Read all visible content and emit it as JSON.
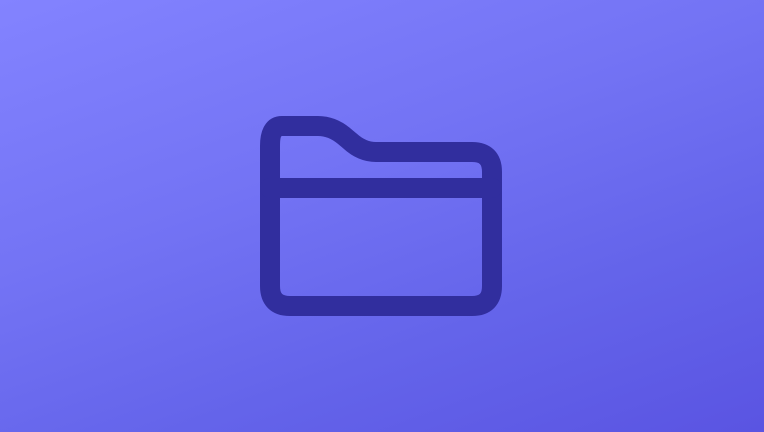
{
  "background": {
    "gradient_start": "#8383ff",
    "gradient_end": "#5a54e2"
  },
  "icon": {
    "name": "folder-icon",
    "stroke_color": "#312e9e"
  }
}
